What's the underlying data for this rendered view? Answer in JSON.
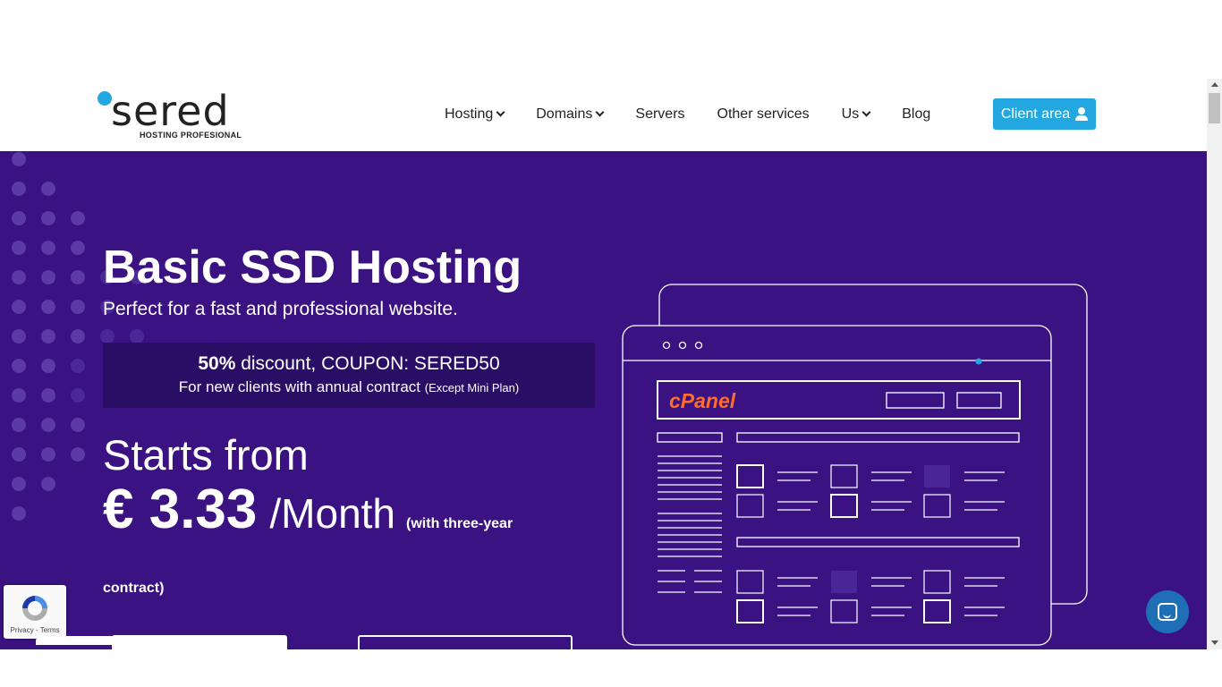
{
  "logo": {
    "word": "sered",
    "tagline": "HOSTING PROFESIONAL"
  },
  "nav": {
    "items": [
      {
        "label": "Hosting",
        "dropdown": true
      },
      {
        "label": "Domains",
        "dropdown": true
      },
      {
        "label": "Servers",
        "dropdown": false
      },
      {
        "label": "Other services",
        "dropdown": false
      },
      {
        "label": "Us",
        "dropdown": true
      },
      {
        "label": "Blog",
        "dropdown": false
      }
    ],
    "client_area": "Client area"
  },
  "hero": {
    "title": "Basic SSD Hosting",
    "subtitle": "Perfect for a fast and professional website.",
    "promo": {
      "discount": "50%",
      "discount_rest": " discount, COUPON: SERED50",
      "new_clients": "For new clients with annual contract ",
      "exception": "(Except Mini Plan)"
    },
    "starts_from": "Starts from",
    "price": "€ 3.33",
    "per": "/Month",
    "contract_a": "(with three-year",
    "contract_b": "contract)"
  },
  "illustration": {
    "brand": "cPanel"
  },
  "recaptcha": {
    "terms": "Privacy - Terms"
  },
  "colors": {
    "hero_bg": "#3a1282",
    "accent": "#22a7e0",
    "cpanel": "#ff6c2c",
    "chat": "#1f6fb6"
  },
  "icons": [
    "user-icon",
    "chevron-down-icon",
    "chat-icon",
    "recaptcha-icon"
  ]
}
